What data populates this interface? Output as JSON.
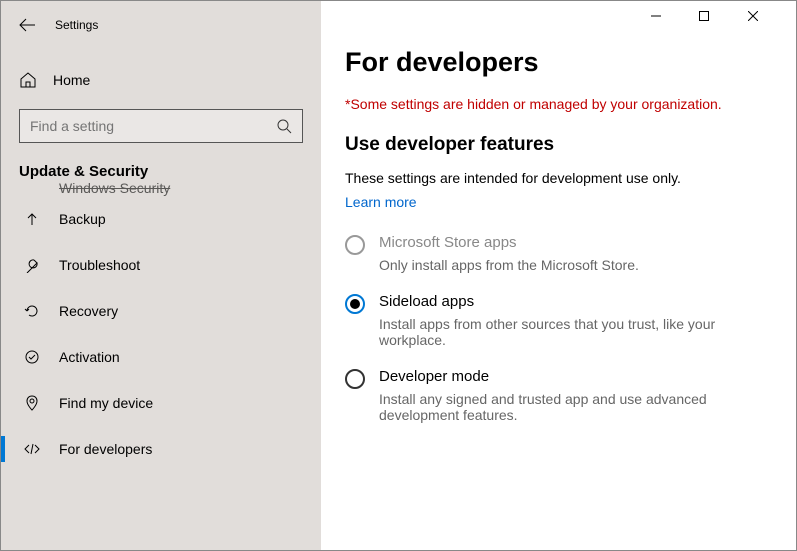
{
  "app": {
    "title": "Settings"
  },
  "search": {
    "placeholder": "Find a setting"
  },
  "home": {
    "label": "Home"
  },
  "category": "Update & Security",
  "nav": {
    "clipped": "Windows Security",
    "items": [
      {
        "label": "Backup"
      },
      {
        "label": "Troubleshoot"
      },
      {
        "label": "Recovery"
      },
      {
        "label": "Activation"
      },
      {
        "label": "Find my device"
      },
      {
        "label": "For developers"
      }
    ]
  },
  "page": {
    "title": "For developers",
    "warning": "*Some settings are hidden or managed by your organization.",
    "section_title": "Use developer features",
    "note": "These settings are intended for development use only.",
    "learn_more": "Learn more",
    "options": [
      {
        "title": "Microsoft Store apps",
        "desc": "Only install apps from the Microsoft Store.",
        "state": "disabled"
      },
      {
        "title": "Sideload apps",
        "desc": "Install apps from other sources that you trust, like your workplace.",
        "state": "selected"
      },
      {
        "title": "Developer mode",
        "desc": "Install any signed and trusted app and use advanced development features.",
        "state": "normal"
      }
    ]
  }
}
